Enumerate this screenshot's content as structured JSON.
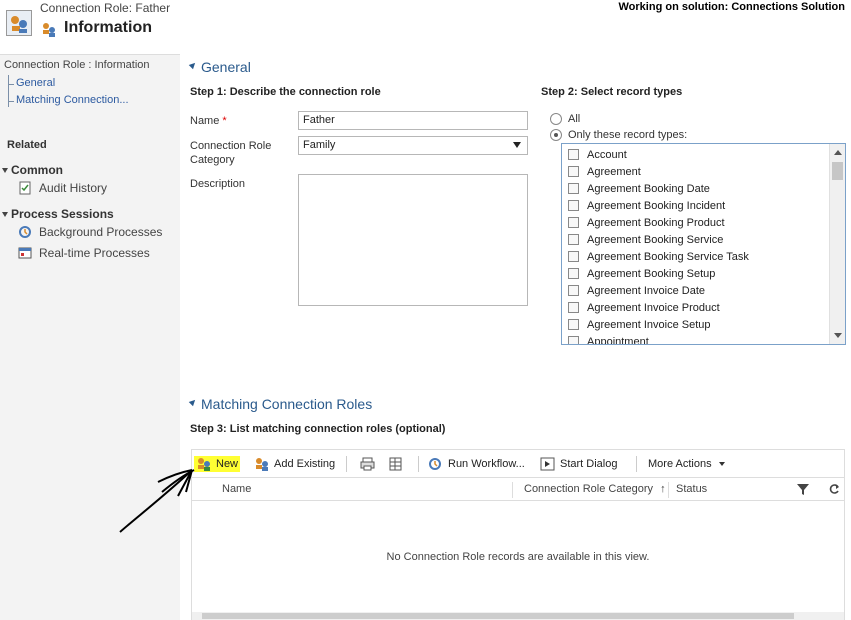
{
  "header": {
    "subtitle": "Connection Role: Father",
    "title": "Information",
    "solution": "Working on solution: Connections Solution"
  },
  "sidebar": {
    "crumb": "Connection Role : Information",
    "nav": [
      "General",
      "Matching Connection..."
    ],
    "related": "Related",
    "common": "Common",
    "audit_history": "Audit History",
    "process_sessions": "Process Sessions",
    "background_processes": "Background Processes",
    "realtime_processes": "Real-time Processes"
  },
  "general": {
    "title": "General",
    "step1": "Step 1: Describe the connection role",
    "name_label": "Name",
    "name_value": "Father",
    "category_label": "Connection Role Category",
    "category_value": "Family",
    "description_label": "Description",
    "step2": "Step 2: Select record types",
    "radio_all": "All",
    "radio_only": "Only these record types:",
    "record_types": [
      "Account",
      "Agreement",
      "Agreement Booking Date",
      "Agreement Booking Incident",
      "Agreement Booking Product",
      "Agreement Booking Service",
      "Agreement Booking Service Task",
      "Agreement Booking Setup",
      "Agreement Invoice Date",
      "Agreement Invoice Product",
      "Agreement Invoice Setup",
      "Appointment"
    ]
  },
  "matching": {
    "title": "Matching Connection Roles",
    "step3": "Step 3: List matching connection roles (optional)",
    "toolbar": {
      "new": "New",
      "add_existing": "Add Existing",
      "run_workflow": "Run Workflow...",
      "start_dialog": "Start Dialog",
      "more_actions": "More Actions"
    },
    "columns": {
      "name": "Name",
      "category": "Connection Role Category",
      "status": "Status"
    },
    "empty": "No Connection Role records are available in this view."
  },
  "colors": {
    "section_title": "#2a5a8c",
    "highlight": "#ffff33",
    "sidebar_bg": "#f3f3f3"
  }
}
